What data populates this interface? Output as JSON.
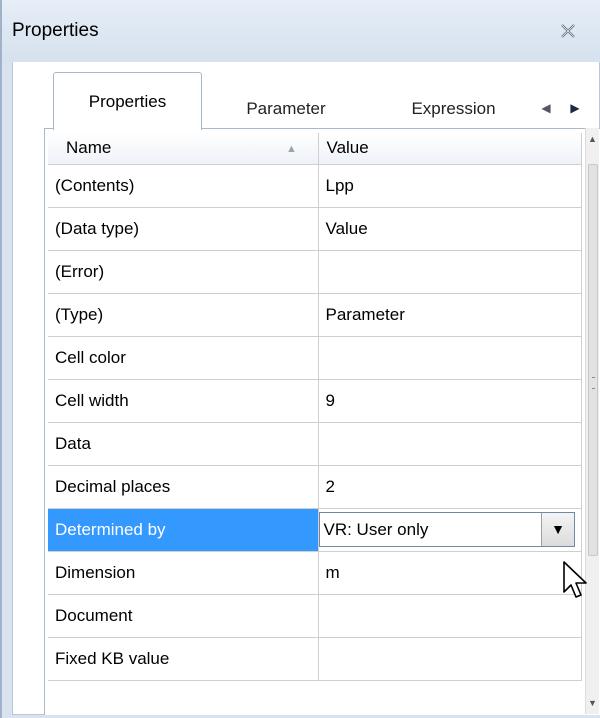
{
  "window": {
    "title": "Properties",
    "close_icon": "close-icon"
  },
  "tabs": [
    {
      "label": "Properties",
      "active": true
    },
    {
      "label": "Parameter",
      "active": false
    },
    {
      "label": "Expression",
      "active": false
    }
  ],
  "grid": {
    "headers": {
      "name": "Name",
      "value": "Value"
    },
    "rows": [
      {
        "name": "(Contents)",
        "value": "Lpp"
      },
      {
        "name": "(Data type)",
        "value": "Value"
      },
      {
        "name": "(Error)",
        "value": ""
      },
      {
        "name": "(Type)",
        "value": "Parameter"
      },
      {
        "name": "Cell color",
        "value": ""
      },
      {
        "name": "Cell width",
        "value": "9"
      },
      {
        "name": "Data",
        "value": ""
      },
      {
        "name": "Decimal places",
        "value": "2"
      },
      {
        "name": "Determined by",
        "value": "VR:  User only",
        "selected": true
      },
      {
        "name": "Dimension",
        "value": "m"
      },
      {
        "name": "Document",
        "value": ""
      },
      {
        "name": "Fixed KB value",
        "value": ""
      }
    ]
  },
  "colors": {
    "selection": "#3399ff",
    "frame": "#d8e3ef"
  }
}
